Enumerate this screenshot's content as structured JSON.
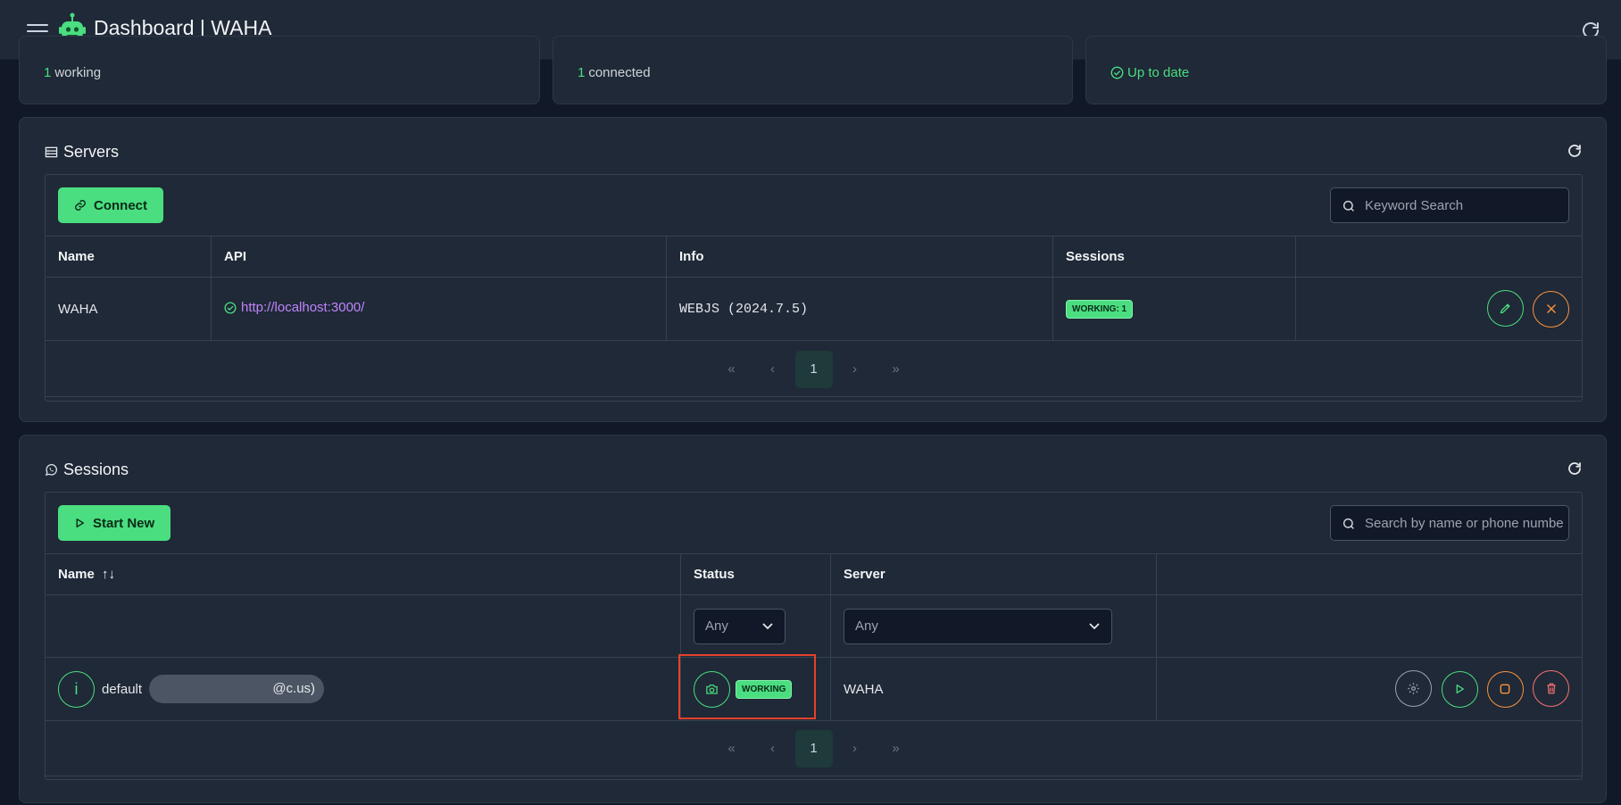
{
  "header": {
    "title": "Dashboard | WAHA"
  },
  "stats": [
    {
      "number": "1",
      "text": "working"
    },
    {
      "number": "1",
      "text": "connected"
    },
    {
      "text": "Up to date"
    }
  ],
  "servers": {
    "title": "Servers",
    "connect_label": "Connect",
    "search_placeholder": "Keyword Search",
    "columns": [
      "Name",
      "API",
      "Info",
      "Sessions",
      ""
    ],
    "rows": [
      {
        "name": "WAHA",
        "api": "http://localhost:3000/",
        "info": "WEBJS (2024.7.5)",
        "sessions_badge": "WORKING: 1"
      }
    ],
    "pagination": {
      "first": "«",
      "prev": "‹",
      "current": "1",
      "next": "›",
      "last": "»"
    }
  },
  "sessions": {
    "title": "Sessions",
    "start_label": "Start New",
    "search_placeholder": "Search by name or phone number",
    "columns": {
      "name": "Name",
      "sort": "↑↓",
      "status": "Status",
      "server": "Server"
    },
    "filters": {
      "status": "Any",
      "server": "Any"
    },
    "rows": [
      {
        "avatar": "i",
        "name": "default",
        "phone_suffix": "@c.us)",
        "status": "WORKING",
        "server": "WAHA"
      }
    ],
    "pagination": {
      "first": "«",
      "prev": "‹",
      "current": "1",
      "next": "›",
      "last": "»"
    }
  },
  "colors": {
    "accent": "#4ade80",
    "warn": "#fb923c",
    "danger": "#f87171",
    "link": "#c084fc",
    "highlight": "#e5412a"
  }
}
